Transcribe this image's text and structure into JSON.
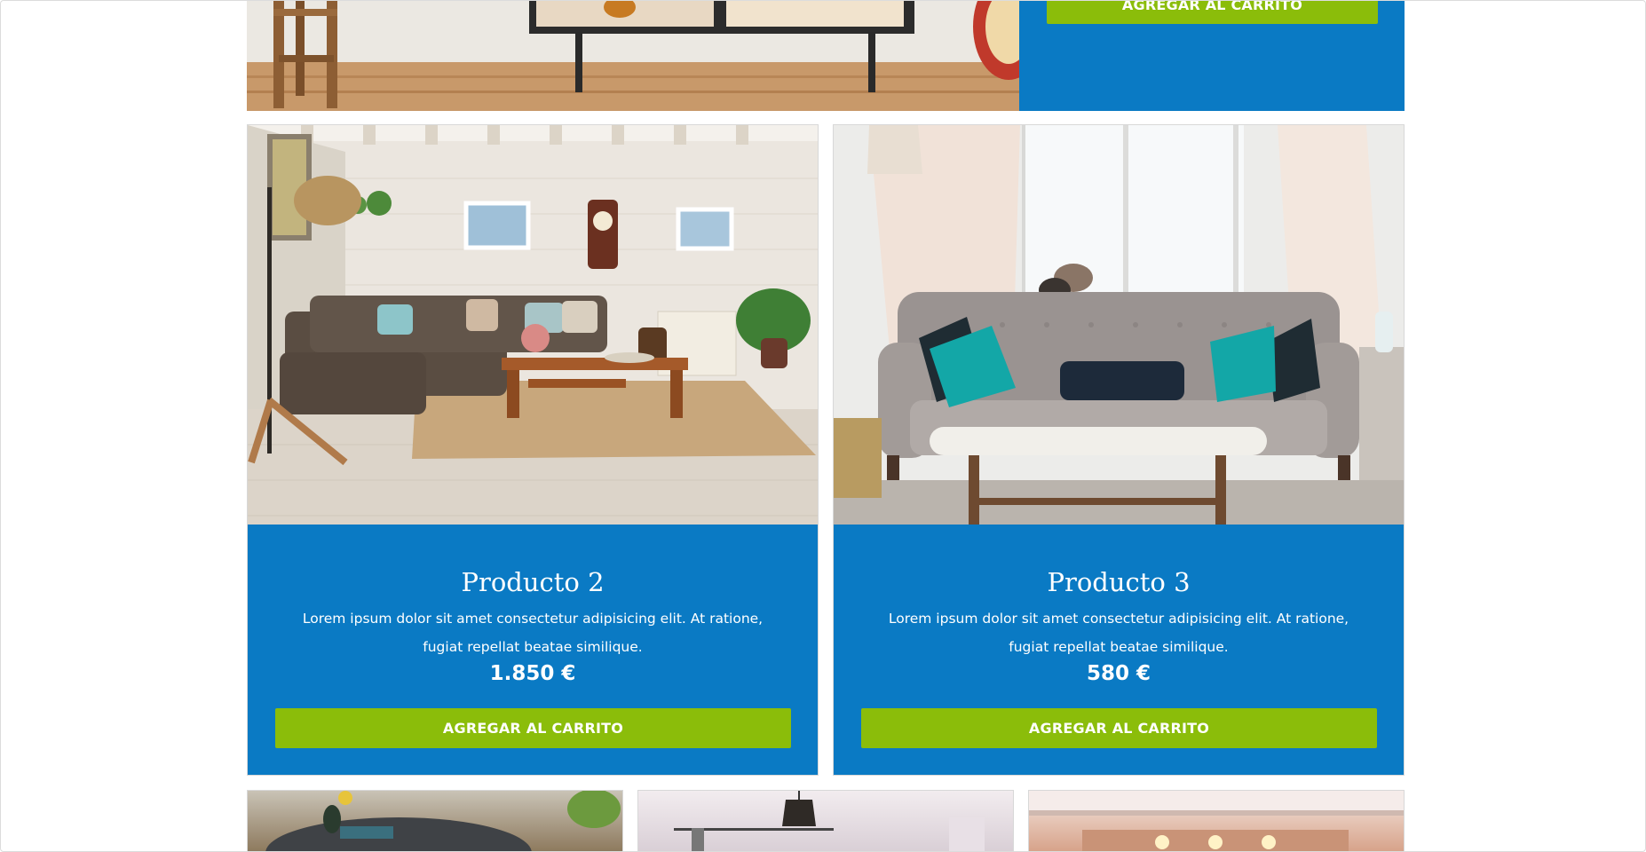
{
  "products_top": {
    "button_label": "AGREGAR AL CARRITO"
  },
  "products": [
    {
      "title": "Producto 2",
      "description": "Lorem ipsum dolor sit amet consectetur adipisicing elit. At ratione, fugiat repellat beatae similique.",
      "price": "1.850 €",
      "button_label": "AGREGAR AL CARRITO",
      "image": "living-room-brown-sofa-photo"
    },
    {
      "title": "Producto 3",
      "description": "Lorem ipsum dolor sit amet consectetur adipisicing elit. At ratione, fugiat repellat beatae similique.",
      "price": "580 €",
      "button_label": "AGREGAR AL CARRITO",
      "image": "grey-sofa-with-cat-photo"
    }
  ],
  "colors": {
    "card_background": "#0a7ac4",
    "button_background": "#8bbd0a",
    "text": "#ffffff"
  }
}
